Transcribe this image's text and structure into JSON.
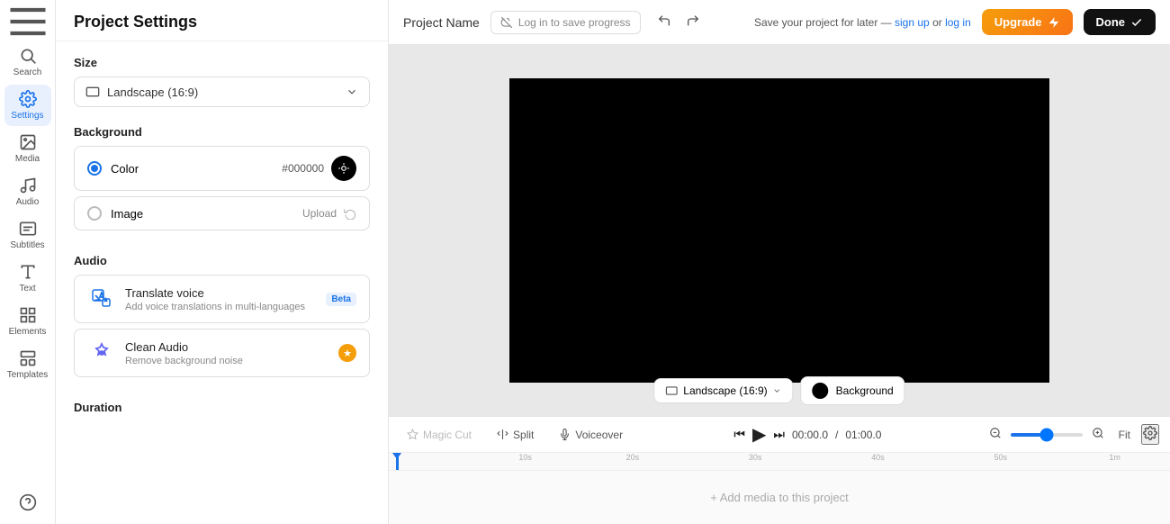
{
  "iconBar": {
    "items": [
      {
        "id": "hamburger",
        "icon": "menu",
        "label": ""
      },
      {
        "id": "search",
        "icon": "search",
        "label": "Search"
      },
      {
        "id": "settings",
        "icon": "settings",
        "label": "Settings",
        "active": true
      },
      {
        "id": "media",
        "icon": "media",
        "label": "Media"
      },
      {
        "id": "audio",
        "icon": "audio",
        "label": "Audio"
      },
      {
        "id": "subtitles",
        "icon": "subtitles",
        "label": "Subtitles"
      },
      {
        "id": "text",
        "icon": "text",
        "label": "Text"
      },
      {
        "id": "elements",
        "icon": "elements",
        "label": "Elements"
      },
      {
        "id": "templates",
        "icon": "templates",
        "label": "Templates"
      },
      {
        "id": "question",
        "icon": "question",
        "label": ""
      }
    ]
  },
  "settingsPanel": {
    "title": "Project Settings",
    "size": {
      "label": "Size",
      "value": "Landscape (16:9)"
    },
    "background": {
      "label": "Background",
      "colorOption": {
        "label": "Color",
        "value": "#000000"
      },
      "imageOption": {
        "label": "Image",
        "uploadLabel": "Upload"
      }
    },
    "audio": {
      "label": "Audio",
      "items": [
        {
          "title": "Translate voice",
          "desc": "Add voice translations in multi-languages",
          "badge": "Beta"
        },
        {
          "title": "Clean Audio",
          "desc": "Remove background noise",
          "badge": "star"
        }
      ]
    },
    "duration": {
      "label": "Duration"
    }
  },
  "topBar": {
    "projectName": "Project Name",
    "saveCloud": "Log in to save progress",
    "saveText": "Save your project for later —",
    "signUp": "sign up",
    "or": "or",
    "logIn": "log in",
    "upgradeLabel": "Upgrade",
    "doneLabel": "Done"
  },
  "canvasControls": {
    "landscapeLabel": "Landscape (16:9)",
    "backgroundLabel": "Background"
  },
  "timeline": {
    "magicCut": "Magic Cut",
    "split": "Split",
    "voiceover": "Voiceover",
    "currentTime": "00:00.0",
    "totalTime": "01:00.0",
    "fitLabel": "Fit",
    "addMediaLabel": "+ Add media to this project",
    "rulerMarks": [
      "10s",
      "20s",
      "30s",
      "40s",
      "50s",
      "1m"
    ]
  }
}
